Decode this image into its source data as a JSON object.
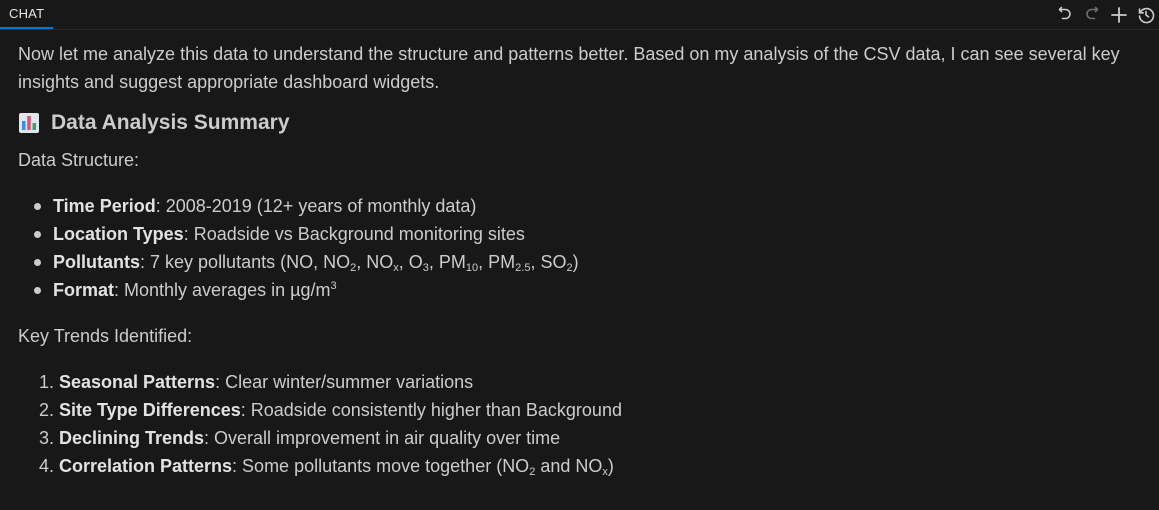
{
  "header": {
    "tab_label": "CHAT",
    "toolbar_icons": [
      "undo-icon",
      "redo-icon",
      "plus-icon",
      "history-icon"
    ]
  },
  "message": {
    "intro_line1": "Now let me analyze this data to understand the structure and patterns better. Based on my analysis of the CSV data, I can see several key",
    "intro_line2": "insights and suggest appropriate dashboard widgets.",
    "heading": "Data Analysis Summary",
    "heading_icon": "bar-chart-emoji-icon",
    "structure_label": "Data Structure:",
    "structure": {
      "time_key": "Time Period",
      "time_val": ": 2008-2019 (12+ years of monthly data)",
      "loc_key": "Location Types",
      "loc_val": ": Roadside vs Background monitoring sites",
      "poll_key": "Pollutants",
      "poll_val_pre": ": 7 key pollutants (NO, NO",
      "poll_no2_sub": "2",
      "poll_sep1": ", NO",
      "poll_nox_sub": "x",
      "poll_sep2": ", O",
      "poll_o3_sub": "3",
      "poll_sep3": ", PM",
      "poll_pm10_sub": "10",
      "poll_sep4": ", PM",
      "poll_pm25_sub": "2.5",
      "poll_sep5": ", SO",
      "poll_so2_sub": "2",
      "poll_end": ")",
      "fmt_key": "Format",
      "fmt_val": ": Monthly averages in µg/m",
      "fmt_sup": "3"
    },
    "trends_label": "Key Trends Identified:",
    "trends": [
      {
        "num": "1.",
        "key": "Seasonal Patterns",
        "val": ": Clear winter/summer variations"
      },
      {
        "num": "2.",
        "key": "Site Type Differences",
        "val": ": Roadside consistently higher than Background"
      },
      {
        "num": "3.",
        "key": "Declining Trends",
        "val": ": Overall improvement in air quality over time"
      }
    ],
    "trend4": {
      "num": "4.",
      "key": "Correlation Patterns",
      "val_pre": ": Some pollutants move together (NO",
      "sub1": "2",
      "mid": " and NO",
      "sub2": "x",
      "end": ")"
    }
  }
}
